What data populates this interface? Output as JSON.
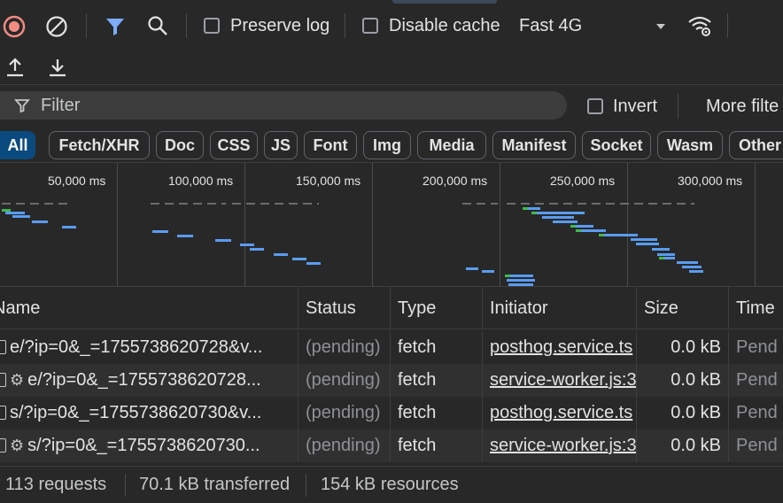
{
  "toolbar": {
    "preserve_log_label": "Preserve log",
    "disable_cache_label": "Disable cache",
    "throttle_value": "Fast 4G",
    "record_icon": "record-stop-icon",
    "clear_icon": "clear-icon",
    "filter_icon": "funnel-icon",
    "search_icon": "search-icon",
    "network_conditions_icon": "wifi-gear-icon",
    "import_icon": "upload-icon",
    "export_icon": "download-icon"
  },
  "filter": {
    "placeholder": "Filter",
    "invert_label": "Invert",
    "more_filters_label": "More filte"
  },
  "type_filters": [
    "All",
    "Fetch/XHR",
    "Doc",
    "CSS",
    "JS",
    "Font",
    "Img",
    "Media",
    "Manifest",
    "Socket",
    "Wasm",
    "Other"
  ],
  "overview": {
    "ticks": [
      "50,000 ms",
      "100,000 ms",
      "150,000 ms",
      "200,000 ms",
      "250,000 ms",
      "300,000 ms"
    ]
  },
  "table": {
    "columns": [
      "Name",
      "Status",
      "Type",
      "Initiator",
      "Size",
      "Time"
    ],
    "rows": [
      {
        "name": "e/?ip=0&_=1755738620728&v...",
        "has_gear": false,
        "status": "(pending)",
        "type": "fetch",
        "initiator": "posthog.service.ts",
        "size": "0.0 kB",
        "time": "Pend"
      },
      {
        "name": "e/?ip=0&_=1755738620728...",
        "has_gear": true,
        "status": "(pending)",
        "type": "fetch",
        "initiator": "service-worker.js:3",
        "size": "0.0 kB",
        "time": "Pend"
      },
      {
        "name": "s/?ip=0&_=1755738620730&v...",
        "has_gear": false,
        "status": "(pending)",
        "type": "fetch",
        "initiator": "posthog.service.ts",
        "size": "0.0 kB",
        "time": "Pend"
      },
      {
        "name": "s/?ip=0&_=1755738620730...",
        "has_gear": true,
        "status": "(pending)",
        "type": "fetch",
        "initiator": "service-worker.js:3",
        "size": "0.0 kB",
        "time": "Pend"
      }
    ]
  },
  "status_bar": {
    "requests": "113 requests",
    "transferred": "70.1 kB transferred",
    "resources": "154 kB resources"
  },
  "colors": {
    "background": "#282828",
    "accent": "#0b4a7e",
    "record_red": "#f28b82",
    "filter_blue": "#7cacf8",
    "bar_blue": "#5a9cf0",
    "bar_green": "#3fb950"
  }
}
